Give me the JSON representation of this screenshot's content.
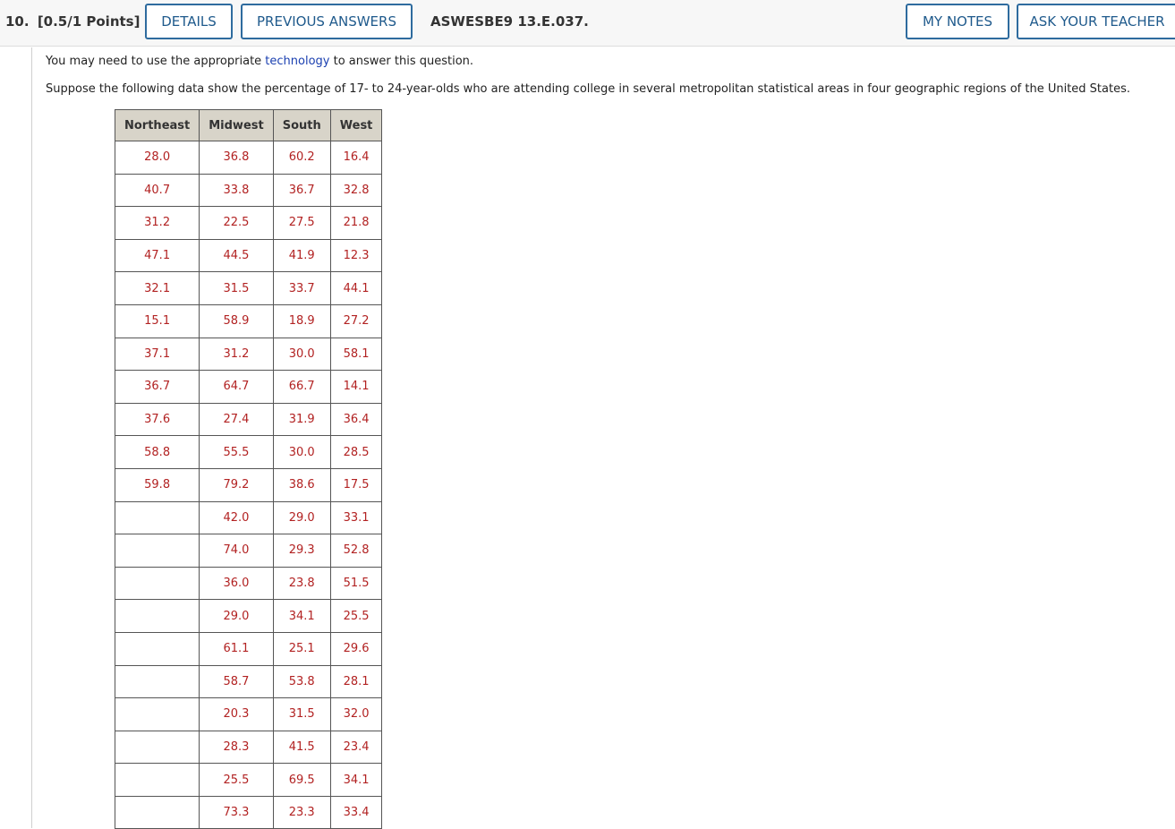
{
  "header": {
    "question_number": "10.",
    "points": "[0.5/1 Points]",
    "details_label": "DETAILS",
    "previous_answers_label": "PREVIOUS ANSWERS",
    "assignment_id": "ASWESBE9 13.E.037.",
    "my_notes_label": "MY NOTES",
    "ask_teacher_label": "ASK YOUR TEACHER"
  },
  "question": {
    "line1_before": "You may need to use the appropriate ",
    "line1_link": "technology",
    "line1_after": " to answer this question.",
    "line2": "Suppose the following data show the percentage of 17- to 24-year-olds who are attending college in several metropolitan statistical areas in four geographic regions of the United States."
  },
  "table": {
    "columns": [
      "Northeast",
      "Midwest",
      "South",
      "West"
    ],
    "rows": [
      [
        "28.0",
        "36.8",
        "60.2",
        "16.4"
      ],
      [
        "40.7",
        "33.8",
        "36.7",
        "32.8"
      ],
      [
        "31.2",
        "22.5",
        "27.5",
        "21.8"
      ],
      [
        "47.1",
        "44.5",
        "41.9",
        "12.3"
      ],
      [
        "32.1",
        "31.5",
        "33.7",
        "44.1"
      ],
      [
        "15.1",
        "58.9",
        "18.9",
        "27.2"
      ],
      [
        "37.1",
        "31.2",
        "30.0",
        "58.1"
      ],
      [
        "36.7",
        "64.7",
        "66.7",
        "14.1"
      ],
      [
        "37.6",
        "27.4",
        "31.9",
        "36.4"
      ],
      [
        "58.8",
        "55.5",
        "30.0",
        "28.5"
      ],
      [
        "59.8",
        "79.2",
        "38.6",
        "17.5"
      ],
      [
        "",
        "42.0",
        "29.0",
        "33.1"
      ],
      [
        "",
        "74.0",
        "29.3",
        "52.8"
      ],
      [
        "",
        "36.0",
        "23.8",
        "51.5"
      ],
      [
        "",
        "29.0",
        "34.1",
        "25.5"
      ],
      [
        "",
        "61.1",
        "25.1",
        "29.6"
      ],
      [
        "",
        "58.7",
        "53.8",
        "28.1"
      ],
      [
        "",
        "20.3",
        "31.5",
        "32.0"
      ],
      [
        "",
        "28.3",
        "41.5",
        "23.4"
      ],
      [
        "",
        "25.5",
        "69.5",
        "34.1"
      ],
      [
        "",
        "73.3",
        "23.3",
        "33.4"
      ]
    ]
  },
  "colors": {
    "value_text": "#b22222",
    "button_border": "#2e6b9e",
    "header_cell_bg": "#d8d4c9",
    "link": "#1a3fb0"
  }
}
